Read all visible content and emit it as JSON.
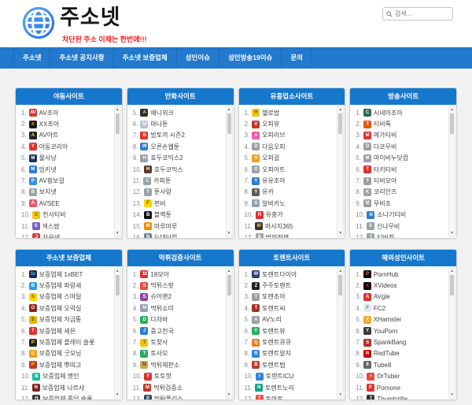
{
  "header": {
    "logo_text": "주소넷",
    "tagline": "차단된 주소 이제는 한번에!!!",
    "search_placeholder": "검색..."
  },
  "nav": {
    "items": [
      "주소넷",
      "주소넷 공지사항",
      "주소넷 보증업체",
      "성인이슈",
      "성인방송19이슈",
      "문의"
    ]
  },
  "icons": {
    "scroll_up": "▲",
    "scroll_down": "▼",
    "search": "magnifier"
  },
  "colors": {
    "nav_bar": "#2279cd",
    "panel_header": "#1678cc",
    "tagline": "#f21b1b",
    "logo_gradient_start": "#55a9f5",
    "logo_gradient_end": "#2b6de0"
  },
  "panels": [
    {
      "title": "야동사이트",
      "items": [
        {
          "n": 1,
          "label": "AV조아",
          "icon": {
            "g": "AV",
            "bg": "#e0312e",
            "fg": "#ffffff"
          }
        },
        {
          "n": 2,
          "label": "XX조아",
          "icon": {
            "g": "X",
            "bg": "#1a1a1a",
            "fg": "#f39c12"
          }
        },
        {
          "n": 3,
          "label": "AV아트",
          "icon": {
            "g": "A",
            "bg": "#222222",
            "fg": "#ffd24a"
          }
        },
        {
          "n": 4,
          "label": "야동코리아",
          "icon": {
            "g": "Y",
            "bg": "#e0312e",
            "fg": "#ffffff"
          }
        },
        {
          "n": 5,
          "label": "물사냥",
          "icon": {
            "g": "M",
            "bg": "#16325c",
            "fg": "#ffffff"
          }
        },
        {
          "n": 6,
          "label": "밍키넷",
          "icon": {
            "g": "M",
            "bg": "#2a7de1",
            "fg": "#ffffff"
          }
        },
        {
          "n": 7,
          "label": "AV핑보걸",
          "icon": {
            "g": "P",
            "bg": "#3b8de0",
            "fg": "#ffffff"
          }
        },
        {
          "n": 8,
          "label": "보지넷",
          "icon": {
            "g": "B",
            "bg": "#98a0a8",
            "fg": "#ffffff"
          }
        },
        {
          "n": 9,
          "label": "AVSEE",
          "icon": {
            "g": "A",
            "bg": "#e8596a",
            "fg": "#ffffff"
          }
        },
        {
          "n": 10,
          "label": "천사티비",
          "icon": {
            "g": "C",
            "bg": "#f5c518",
            "fg": "#6b5300"
          }
        },
        {
          "n": 11,
          "label": "섹스밤",
          "icon": {
            "g": "S",
            "bg": "#7a5cc6",
            "fg": "#ffffff"
          }
        },
        {
          "n": 12,
          "label": "자유넷",
          "icon": {
            "g": "J",
            "bg": "#d04040",
            "fg": "#ffffff"
          }
        }
      ]
    },
    {
      "title": "만화사이트",
      "items": [
        {
          "n": 5,
          "label": "애니위크",
          "icon": {
            "g": "A",
            "bg": "#2f2f2f",
            "fg": "#ffd24a"
          }
        },
        {
          "n": 6,
          "label": "마나툰",
          "icon": {
            "g": "M",
            "bg": "#b9c3cc",
            "fg": "#ffffff"
          }
        },
        {
          "n": 7,
          "label": "밤토끼 시즌2",
          "icon": {
            "g": "B",
            "bg": "#e0312e",
            "fg": "#ffffff"
          }
        },
        {
          "n": 8,
          "label": "오른손웹툰",
          "icon": {
            "g": "W",
            "bg": "#2e7dd1",
            "fg": "#ffffff"
          }
        },
        {
          "n": 9,
          "label": "호두코믹스2",
          "icon": {
            "g": "H",
            "bg": "#98a0a8",
            "fg": "#ffffff"
          }
        },
        {
          "n": 10,
          "label": "호두코믹스",
          "icon": {
            "g": "H",
            "bg": "#5a3825",
            "fg": "#ffffff"
          }
        },
        {
          "n": 11,
          "label": "카피툰",
          "icon": {
            "g": "C",
            "bg": "#98a0a8",
            "fg": "#ffffff"
          }
        },
        {
          "n": 12,
          "label": "툰사랑",
          "icon": {
            "g": "T",
            "bg": "#98a0a8",
            "fg": "#ffffff"
          }
        },
        {
          "n": 13,
          "label": "펀비",
          "icon": {
            "g": "F",
            "bg": "#ffd400",
            "fg": "#6b5300"
          }
        },
        {
          "n": 14,
          "label": "블랙툰",
          "icon": {
            "g": "B",
            "bg": "#111111",
            "fg": "#ffffff"
          }
        },
        {
          "n": 15,
          "label": "마루마루",
          "icon": {
            "g": "M",
            "bg": "#f08c00",
            "fg": "#ffffff"
          }
        },
        {
          "n": 16,
          "label": "늑대닷컴",
          "icon": {
            "g": "N",
            "bg": "#6b7f99",
            "fg": "#ffffff"
          }
        }
      ]
    },
    {
      "title": "유흥업소사이트",
      "items": [
        {
          "n": 1,
          "label": "헬로밤",
          "icon": {
            "g": "H",
            "bg": "#f5c518",
            "fg": "#6b5300"
          }
        },
        {
          "n": 2,
          "label": "오피뷰",
          "icon": {
            "g": "V",
            "bg": "#c0392b",
            "fg": "#ffffff"
          }
        },
        {
          "n": 3,
          "label": "오피러브",
          "icon": {
            "g": "♥",
            "bg": "#ef5fa7",
            "fg": "#ffffff"
          }
        },
        {
          "n": 4,
          "label": "다음오피",
          "icon": {
            "g": "D",
            "bg": "#98a0a8",
            "fg": "#ffffff"
          }
        },
        {
          "n": 5,
          "label": "오피걸",
          "icon": {
            "g": "O",
            "bg": "#f39c12",
            "fg": "#ffffff"
          }
        },
        {
          "n": 6,
          "label": "오피아트",
          "icon": {
            "g": "O",
            "bg": "#98a0a8",
            "fg": "#ffffff"
          }
        },
        {
          "n": 7,
          "label": "유유조아",
          "icon": {
            "g": "Y",
            "bg": "#2e7dd1",
            "fg": "#ffffff"
          }
        },
        {
          "n": 8,
          "label": "유카",
          "icon": {
            "g": "Y",
            "bg": "#5d5d5d",
            "fg": "#ffffff"
          }
        },
        {
          "n": 9,
          "label": "알바카노",
          "icon": {
            "g": "A",
            "bg": "#98a0a8",
            "fg": "#ffffff"
          }
        },
        {
          "n": 10,
          "label": "유흥가",
          "icon": {
            "g": "R",
            "bg": "#e0312e",
            "fg": "#ffffff"
          }
        },
        {
          "n": 11,
          "label": "마사지365",
          "icon": {
            "g": "M",
            "bg": "#333333",
            "fg": "#ffd24a"
          }
        },
        {
          "n": 12,
          "label": "밤의전쟁",
          "icon": {
            "g": "B",
            "bg": "#98a0a8",
            "fg": "#ffffff"
          }
        }
      ]
    },
    {
      "title": "방송사이트",
      "items": [
        {
          "n": 1,
          "label": "시네마조아",
          "icon": {
            "g": "C",
            "bg": "#2d6a4f",
            "fg": "#ffffff"
          }
        },
        {
          "n": 2,
          "label": "티비톡",
          "icon": {
            "g": "T",
            "bg": "#e8590c",
            "fg": "#ffffff"
          }
        },
        {
          "n": 3,
          "label": "메가티비",
          "icon": {
            "g": "M",
            "bg": "#e0312e",
            "fg": "#ffffff"
          }
        },
        {
          "n": 4,
          "label": "다코무비",
          "icon": {
            "g": "D",
            "bg": "#98a0a8",
            "fg": "#ffffff"
          }
        },
        {
          "n": 5,
          "label": "마이비누닷컴",
          "icon": {
            "g": "M",
            "bg": "#98a0a8",
            "fg": "#ffffff"
          }
        },
        {
          "n": 6,
          "label": "타키티비",
          "icon": {
            "g": "T",
            "bg": "#e0312e",
            "fg": "#ffffff"
          }
        },
        {
          "n": 7,
          "label": "티비모아",
          "icon": {
            "g": "T",
            "bg": "#98a0a8",
            "fg": "#ffffff"
          }
        },
        {
          "n": 8,
          "label": "코리안즈",
          "icon": {
            "g": "K",
            "bg": "#98a0a8",
            "fg": "#ffffff"
          }
        },
        {
          "n": 9,
          "label": "무비조",
          "icon": {
            "g": "M",
            "bg": "#98a0a8",
            "fg": "#ffffff"
          }
        },
        {
          "n": 10,
          "label": "소나기티비",
          "icon": {
            "g": "N",
            "bg": "#2e7dd1",
            "fg": "#ffffff"
          }
        },
        {
          "n": 11,
          "label": "신나무비",
          "icon": {
            "g": "S",
            "bg": "#98a0a8",
            "fg": "#ffffff"
          }
        },
        {
          "n": 12,
          "label": "티비착",
          "icon": {
            "g": "T",
            "bg": "#98a0a8",
            "fg": "#ffffff"
          }
        }
      ]
    },
    {
      "title": "주소넷 보증업체",
      "items": [
        {
          "n": 1,
          "label": "보증업체 1xBET",
          "icon": {
            "g": "1x",
            "bg": "#1b2a4a",
            "fg": "#4fc3f7"
          }
        },
        {
          "n": 2,
          "label": "보증업체 파랑새",
          "icon": {
            "g": "B",
            "bg": "#2e9ae0",
            "fg": "#ffffff"
          }
        },
        {
          "n": 3,
          "label": "보증업체 스마일",
          "icon": {
            "g": "S",
            "bg": "#ffd400",
            "fg": "#6b5300"
          }
        },
        {
          "n": 4,
          "label": "보증업체 오락실",
          "icon": {
            "g": "O",
            "bg": "#8e2323",
            "fg": "#ffffff"
          }
        },
        {
          "n": 5,
          "label": "보증업체 저금통",
          "icon": {
            "g": "$",
            "bg": "#e6b800",
            "fg": "#6b5300"
          }
        },
        {
          "n": 6,
          "label": "보증업체 세븐",
          "icon": {
            "g": "7",
            "bg": "#e0312e",
            "fg": "#ffffff"
          }
        },
        {
          "n": 7,
          "label": "보증업체 플레이 슬롯",
          "icon": {
            "g": "P",
            "bg": "#222222",
            "fg": "#ffd24a"
          }
        },
        {
          "n": 8,
          "label": "보증업체 굿모닝",
          "icon": {
            "g": "G",
            "bg": "#f39c12",
            "fg": "#ffffff"
          }
        },
        {
          "n": 9,
          "label": "보증업체 뿌띠고",
          "icon": {
            "g": "P",
            "bg": "#c0392b",
            "fg": "#ffd700"
          }
        },
        {
          "n": 10,
          "label": "보증업체 벳인",
          "icon": {
            "g": "B",
            "bg": "#1abc9c",
            "fg": "#ffffff"
          }
        },
        {
          "n": 11,
          "label": "보증업체 나르샤",
          "icon": {
            "g": "N",
            "bg": "#7b241c",
            "fg": "#ffffff"
          }
        },
        {
          "n": 12,
          "label": "보증업체 홀덤 슬롯",
          "icon": {
            "g": "H",
            "bg": "#333333",
            "fg": "#ffffff"
          }
        }
      ]
    },
    {
      "title": "먹튀검증사이트",
      "items": [
        {
          "n": 1,
          "label": "18모아",
          "icon": {
            "g": "18",
            "bg": "#e0312e",
            "fg": "#ffffff"
          }
        },
        {
          "n": 2,
          "label": "먹튀스팟",
          "icon": {
            "g": "S",
            "bg": "#e74c3c",
            "fg": "#ffffff"
          }
        },
        {
          "n": 3,
          "label": "슈어맨2",
          "icon": {
            "g": "S",
            "bg": "#8e44ad",
            "fg": "#ffffff"
          }
        },
        {
          "n": 4,
          "label": "먹튀쇼미",
          "icon": {
            "g": "M",
            "bg": "#98a0a8",
            "fg": "#ffffff"
          }
        },
        {
          "n": 5,
          "label": "다자바",
          "icon": {
            "g": "D",
            "bg": "#27ae60",
            "fg": "#ffffff"
          }
        },
        {
          "n": 6,
          "label": "중고천국",
          "icon": {
            "g": "J",
            "bg": "#2e7dd1",
            "fg": "#ffffff"
          }
        },
        {
          "n": 7,
          "label": "토찾사",
          "icon": {
            "g": "T",
            "bg": "#f1c40f",
            "fg": "#7a5b00"
          }
        },
        {
          "n": 8,
          "label": "토사모",
          "icon": {
            "g": "T",
            "bg": "#27ae60",
            "fg": "#ffffff"
          }
        },
        {
          "n": 9,
          "label": "먹튀재판소",
          "icon": {
            "g": "M",
            "bg": "#c8a951",
            "fg": "#5b4500"
          }
        },
        {
          "n": 10,
          "label": "토토핫",
          "icon": {
            "g": "T",
            "bg": "#e0312e",
            "fg": "#ffffff"
          }
        },
        {
          "n": 11,
          "label": "먹튀검증소",
          "icon": {
            "g": "M",
            "bg": "#c0392b",
            "fg": "#ffffff"
          }
        },
        {
          "n": 12,
          "label": "먹튀폴리스",
          "icon": {
            "g": "P",
            "bg": "#34495e",
            "fg": "#ffffff"
          }
        }
      ]
    },
    {
      "title": "토렌트사이트",
      "items": [
        {
          "n": 1,
          "label": "토렌트다이아",
          "icon": {
            "g": "W",
            "bg": "#2c3e7b",
            "fg": "#ffffff"
          }
        },
        {
          "n": 2,
          "label": "주주토렌트",
          "icon": {
            "g": "Z",
            "bg": "#222222",
            "fg": "#ffffff"
          }
        },
        {
          "n": 3,
          "label": "토렌조아",
          "icon": {
            "g": "T",
            "bg": "#98a0a8",
            "fg": "#ffffff"
          }
        },
        {
          "n": 4,
          "label": "토렌트씨",
          "icon": {
            "g": "T",
            "bg": "#a93226",
            "fg": "#ffffff"
          }
        },
        {
          "n": 5,
          "label": "AV노리",
          "icon": {
            "g": "A",
            "bg": "#98a0a8",
            "fg": "#ffffff"
          }
        },
        {
          "n": 6,
          "label": "토렌트뷰",
          "icon": {
            "g": "V",
            "bg": "#27ae60",
            "fg": "#ffffff"
          }
        },
        {
          "n": 7,
          "label": "토렌트큐큐",
          "icon": {
            "g": "Q",
            "bg": "#e67e22",
            "fg": "#ffffff"
          }
        },
        {
          "n": 8,
          "label": "토렌트알지",
          "icon": {
            "g": "R",
            "bg": "#2e86de",
            "fg": "#ffffff"
          }
        },
        {
          "n": 9,
          "label": "토렌트범",
          "icon": {
            "g": "B",
            "bg": "#c0392b",
            "fg": "#ffffff"
          }
        },
        {
          "n": 10,
          "label": "토렌트ICU",
          "icon": {
            "g": "I",
            "bg": "#2e86de",
            "fg": "#ffffff"
          }
        },
        {
          "n": 11,
          "label": "토렌트노리",
          "icon": {
            "g": "N",
            "bg": "#16a085",
            "fg": "#ffffff"
          }
        },
        {
          "n": 12,
          "label": "토마토",
          "icon": {
            "g": "T",
            "bg": "#e74c3c",
            "fg": "#ffffff"
          }
        }
      ]
    },
    {
      "title": "해외성인사이트",
      "items": [
        {
          "n": 1,
          "label": "PornHub",
          "icon": {
            "g": "P",
            "bg": "#000000",
            "fg": "#ff9000"
          }
        },
        {
          "n": 2,
          "label": "XVideos",
          "icon": {
            "g": "X",
            "bg": "#000000",
            "fg": "#e0312e"
          }
        },
        {
          "n": 3,
          "label": "AVgle",
          "icon": {
            "g": "A",
            "bg": "#e0312e",
            "fg": "#ffffff"
          }
        },
        {
          "n": 4,
          "label": "FC2",
          "icon": {
            "g": "F",
            "bg": "#e8e8e8",
            "fg": "#2e86de"
          }
        },
        {
          "n": 5,
          "label": "XHamster",
          "icon": {
            "g": "X",
            "bg": "#f5a623",
            "fg": "#ffffff"
          }
        },
        {
          "n": 6,
          "label": "YouPorn",
          "icon": {
            "g": "Y",
            "bg": "#3a3a3a",
            "fg": "#ffffff"
          }
        },
        {
          "n": 7,
          "label": "SpankBang",
          "icon": {
            "g": "S",
            "bg": "#b03030",
            "fg": "#ffffff"
          }
        },
        {
          "n": 8,
          "label": "RedTube",
          "icon": {
            "g": "R",
            "bg": "#cc0000",
            "fg": "#ffffff"
          }
        },
        {
          "n": 9,
          "label": "Tube8",
          "icon": {
            "g": "8",
            "bg": "#666666",
            "fg": "#ffffff"
          }
        },
        {
          "n": 10,
          "label": "DrTuber",
          "icon": {
            "g": "+",
            "bg": "#e74c3c",
            "fg": "#ffffff"
          }
        },
        {
          "n": 11,
          "label": "Pornone",
          "icon": {
            "g": "P",
            "bg": "#e0312e",
            "fg": "#ffffff"
          }
        },
        {
          "n": 12,
          "label": "Thumbzilla",
          "icon": {
            "g": "T",
            "bg": "#333333",
            "fg": "#ffffff"
          }
        }
      ]
    }
  ]
}
